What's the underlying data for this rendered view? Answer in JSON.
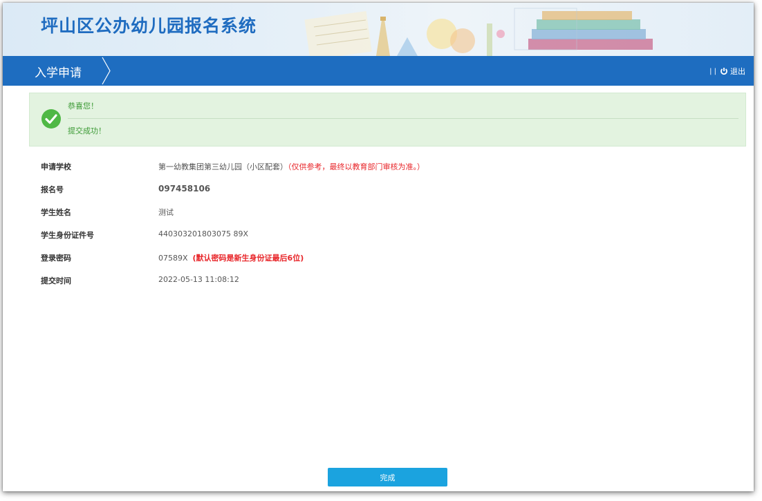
{
  "header": {
    "system_title": "坪山区公办幼儿园报名系统"
  },
  "nav": {
    "page_title": "入学申请",
    "logout_label": "退出"
  },
  "success": {
    "title": "恭喜您！",
    "message": "提交成功！"
  },
  "info": {
    "rows": [
      {
        "label": "申请学校",
        "value": "第一幼教集团第三幼儿园（小区配套）",
        "note": "（仅供参考，最终以教育部门审核为准。）"
      },
      {
        "label": "报名号",
        "value": "097458106"
      },
      {
        "label": "学生姓名",
        "value": "测试"
      },
      {
        "label": "学生身份证件号",
        "value": "440303201803075 89X"
      },
      {
        "label": "登录密码",
        "value": "07589X",
        "note": "(默认密码是新生身份证最后6位)"
      },
      {
        "label": "提交时间",
        "value": "2022-05-13 11:08:12"
      }
    ]
  },
  "footer": {
    "finish_label": "完成"
  },
  "colors": {
    "brand_blue": "#1e6dc0",
    "title_blue": "#1f6cc0",
    "success_green": "#3c9a35",
    "success_bg": "#e3f3e0",
    "alert_red": "#e8262a",
    "button_blue": "#1ba3df"
  },
  "icons": {
    "success": "check-circle-icon",
    "logout": "power-icon",
    "nav_separator": "chevron-right-icon"
  }
}
